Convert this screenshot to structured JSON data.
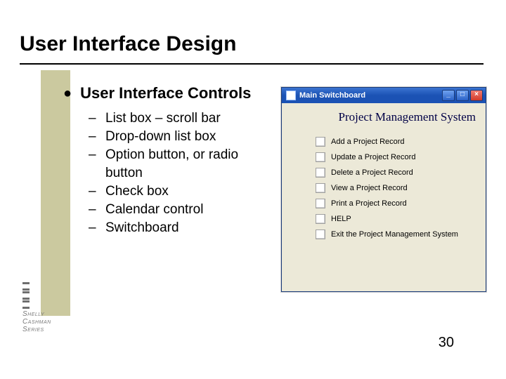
{
  "title": "User Interface Design",
  "bullet": "User Interface Controls",
  "subs": [
    "List box – scroll bar",
    "Drop-down list box",
    "Option button, or radio button",
    "Check box",
    "Calendar control",
    "Switchboard"
  ],
  "logo": {
    "l1": "Shelly",
    "l2": "Cashman",
    "l3": "Series"
  },
  "switchboard": {
    "window_title": "Main Switchboard",
    "heading": "Project Management System",
    "items": [
      "Add a Project Record",
      "Update a Project Record",
      "Delete a Project Record",
      "View a Project Record",
      "Print a Project Record",
      "HELP",
      "Exit the Project Management System"
    ],
    "btn_min": "_",
    "btn_max": "□",
    "btn_close": "×"
  },
  "page_number": "30"
}
